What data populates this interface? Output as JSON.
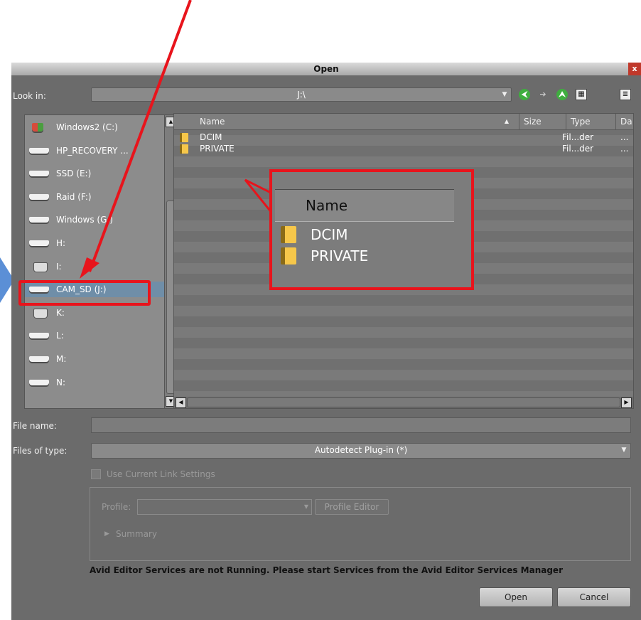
{
  "window": {
    "title": "Open",
    "close_glyph": "x"
  },
  "look_in": {
    "label": "Look in:",
    "value": "J:\\"
  },
  "drives": [
    {
      "label": "Windows2 (C:)",
      "icon": "windows-drive-icon"
    },
    {
      "label": "HP_RECOVERY ...",
      "icon": "hard-drive-icon"
    },
    {
      "label": "SSD (E:)",
      "icon": "hard-drive-icon"
    },
    {
      "label": "Raid (F:)",
      "icon": "hard-drive-icon"
    },
    {
      "label": "Windows (G:)",
      "icon": "hard-drive-icon"
    },
    {
      "label": "H:",
      "icon": "hard-drive-icon"
    },
    {
      "label": "I:",
      "icon": "network-drive-icon"
    },
    {
      "label": "CAM_SD (J:)",
      "icon": "hard-drive-icon",
      "selected": true
    },
    {
      "label": "K:",
      "icon": "network-drive-icon"
    },
    {
      "label": "L:",
      "icon": "hard-drive-icon"
    },
    {
      "label": "M:",
      "icon": "hard-drive-icon"
    },
    {
      "label": "N:",
      "icon": "hard-drive-icon"
    }
  ],
  "file_list": {
    "columns": [
      "Name",
      "Size",
      "Type",
      "Da"
    ],
    "sort_glyph": "▲",
    "rows": [
      {
        "name": "DCIM",
        "type": "Fil...der",
        "date": "..."
      },
      {
        "name": "PRIVATE",
        "type": "Fil...der",
        "date": "..."
      }
    ]
  },
  "file_name": {
    "label": "File name:",
    "value": ""
  },
  "files_of_type": {
    "label": "Files of type:",
    "value": "Autodetect Plug-in (*)"
  },
  "link_settings": {
    "checkbox_label": "Use Current Link Settings",
    "profile_label": "Profile:",
    "profile_editor_label": "Profile Editor",
    "summary_label": "Summary",
    "summary_glyph": "▶"
  },
  "status_message": "Avid Editor Services are not Running. Please start Services from the Avid Editor Services Manager",
  "buttons": {
    "open": "Open",
    "cancel": "Cancel"
  },
  "zoom_inset": {
    "header": "Name",
    "rows": [
      "DCIM",
      "PRIVATE"
    ]
  },
  "colors": {
    "annotation_red": "#e8141c",
    "selection_blue": "#6f8ea8",
    "dialog_bg": "#6b6b6b"
  }
}
